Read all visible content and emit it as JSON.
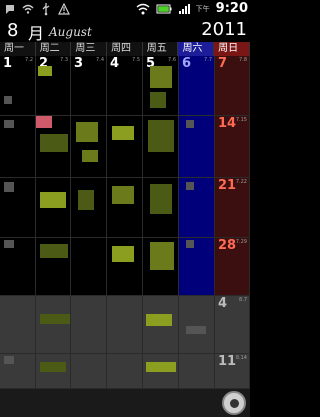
{
  "status_bar": {
    "time_prefix": "下午",
    "time": "9:20"
  },
  "header": {
    "month_number": "8",
    "month_char": "月",
    "month_en": "August",
    "year": "2011"
  },
  "weekdays": [
    "周一",
    "周二",
    "周三",
    "周四",
    "周五",
    "周六",
    "周日"
  ],
  "weeks": [
    {
      "days": [
        {
          "num": "1",
          "lunar": "7.2"
        },
        {
          "num": "2",
          "lunar": "7.3"
        },
        {
          "num": "3",
          "lunar": "7.4"
        },
        {
          "num": "4",
          "lunar": "7.5"
        },
        {
          "num": "5",
          "lunar": "7.6"
        },
        {
          "num": "6",
          "lunar": "7.7"
        },
        {
          "num": "7",
          "lunar": "7.8"
        }
      ]
    },
    {
      "days": [
        {
          "num": "",
          "lunar": ""
        },
        {
          "num": "",
          "lunar": ""
        },
        {
          "num": "",
          "lunar": ""
        },
        {
          "num": "",
          "lunar": ""
        },
        {
          "num": "",
          "lunar": ""
        },
        {
          "num": "",
          "lunar": ""
        },
        {
          "num": "14",
          "lunar": "7.15"
        }
      ]
    },
    {
      "days": [
        {
          "num": "",
          "lunar": ""
        },
        {
          "num": "",
          "lunar": ""
        },
        {
          "num": "",
          "lunar": ""
        },
        {
          "num": "",
          "lunar": ""
        },
        {
          "num": "",
          "lunar": ""
        },
        {
          "num": "",
          "lunar": ""
        },
        {
          "num": "21",
          "lunar": "7.22"
        }
      ]
    },
    {
      "days": [
        {
          "num": "",
          "lunar": ""
        },
        {
          "num": "",
          "lunar": ""
        },
        {
          "num": "",
          "lunar": ""
        },
        {
          "num": "",
          "lunar": ""
        },
        {
          "num": "",
          "lunar": ""
        },
        {
          "num": "",
          "lunar": ""
        },
        {
          "num": "28",
          "lunar": "7.29"
        }
      ]
    },
    {
      "days": [
        {
          "num": "",
          "lunar": ""
        },
        {
          "num": "",
          "lunar": ""
        },
        {
          "num": "",
          "lunar": ""
        },
        {
          "num": "",
          "lunar": ""
        },
        {
          "num": "",
          "lunar": ""
        },
        {
          "num": "",
          "lunar": ""
        },
        {
          "num": "4",
          "lunar": "8.7"
        }
      ]
    },
    {
      "days": [
        {
          "num": "",
          "lunar": ""
        },
        {
          "num": "",
          "lunar": ""
        },
        {
          "num": "",
          "lunar": ""
        },
        {
          "num": "",
          "lunar": ""
        },
        {
          "num": "",
          "lunar": ""
        },
        {
          "num": "",
          "lunar": ""
        },
        {
          "num": "11",
          "lunar": "8.14"
        }
      ]
    }
  ]
}
